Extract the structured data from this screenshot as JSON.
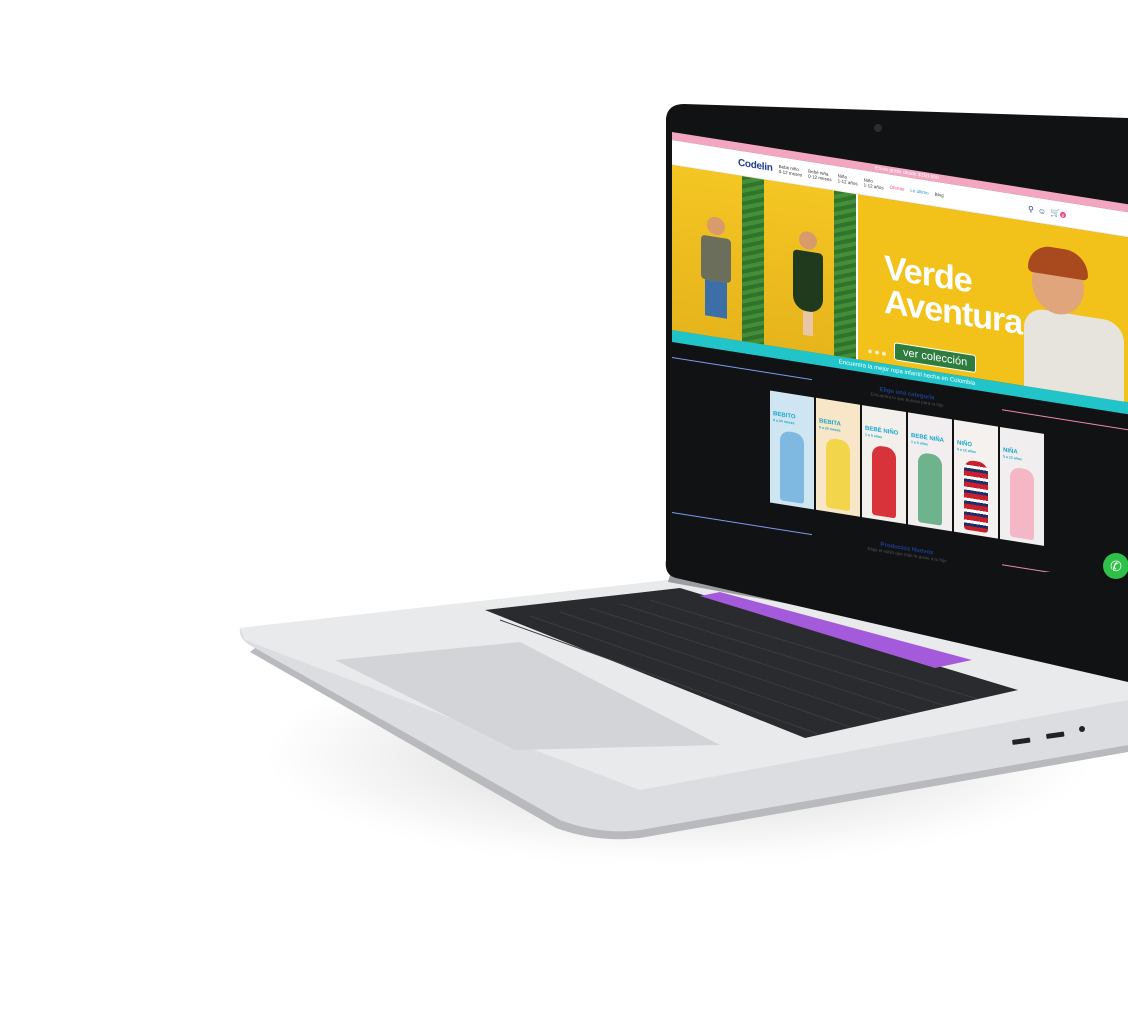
{
  "promo_bar": {
    "text": "Envío gratis desde $150.000"
  },
  "nav": {
    "logo": "Codelin",
    "items": [
      {
        "label": "Bebé niño",
        "sub": "0-12 meses"
      },
      {
        "label": "Bebé niña",
        "sub": "0-12 meses"
      },
      {
        "label": "Niña",
        "sub": "1-12 años"
      },
      {
        "label": "Niño",
        "sub": "1-12 años"
      },
      {
        "label": "Ofertas"
      },
      {
        "label": "Lo último"
      },
      {
        "label": "Blog"
      }
    ],
    "cart_count": "0",
    "icons": [
      "search-icon",
      "user-icon",
      "cart-icon"
    ]
  },
  "hero": {
    "title_line1": "Verde",
    "title_line2": "Aventura",
    "cta": "ver colección"
  },
  "teal_bar": {
    "text": "Encuentra la mejor ropa infantil hecha en Colombia"
  },
  "categories": {
    "title": "Elige una categoría",
    "subtitle": "Encuentra lo que buscas para tu hijo",
    "items": [
      {
        "label": "BEBITO",
        "sub": "0 a 24 meses",
        "color": "#cfe6f2"
      },
      {
        "label": "BEBITA",
        "sub": "0 a 24 meses",
        "color": "#f7e7c8"
      },
      {
        "label": "BEBÉ NIÑO",
        "sub": "1 a 5 años",
        "color": "#f3f0ec"
      },
      {
        "label": "BEBÉ NIÑA",
        "sub": "1 a 5 años",
        "color": "#f2eef0"
      },
      {
        "label": "NIÑO",
        "sub": "5 a 12 años",
        "color": "#f4f1ee"
      },
      {
        "label": "NIÑA",
        "sub": "5 a 12 años",
        "color": "#f1eef0"
      }
    ]
  },
  "products": {
    "title": "Productos Nuevos",
    "subtitle": "Elige el estilo que más le guste a tu hijo"
  },
  "colors": {
    "brand_blue": "#1d3d8f",
    "hero_yellow": "#f2c21b",
    "teal": "#21c4c8",
    "pink": "#e8508b",
    "whatsapp_green": "#2fc04a"
  }
}
